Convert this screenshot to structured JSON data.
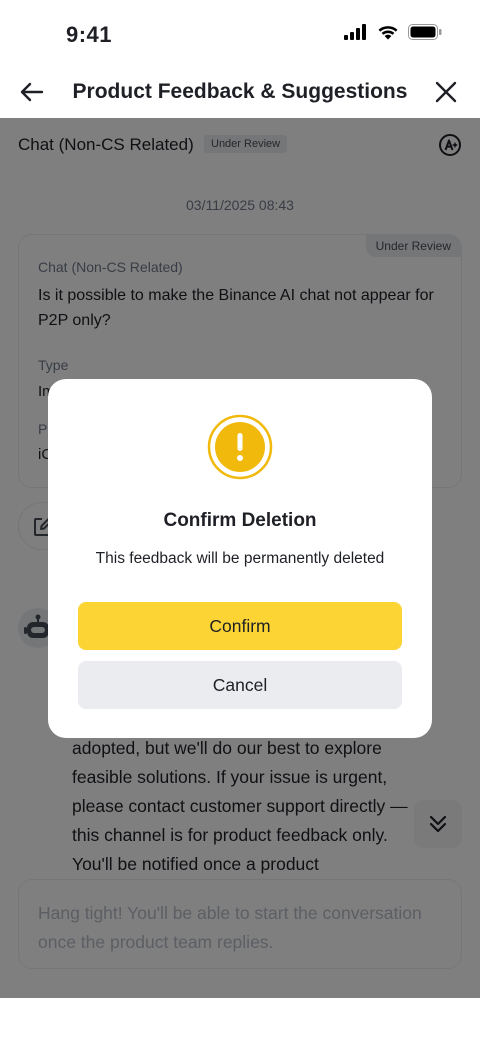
{
  "status_bar": {
    "time": "9:41",
    "icons": [
      "signal-icon",
      "wifi-icon",
      "battery-icon"
    ]
  },
  "nav": {
    "title": "Product Feedback & Suggestions",
    "back_icon": "arrow-left-icon",
    "close_icon": "close-icon"
  },
  "chat_header": {
    "title": "Chat (Non-CS Related)",
    "status_badge": "Under Review",
    "ai_icon": "ai-chip-icon"
  },
  "timestamp": "03/11/2025 08:43",
  "feedback_card": {
    "status_badge": "Under Review",
    "category": "Chat (Non-CS Related)",
    "question": "Is it possible to make the Binance AI chat not appear for P2P only?",
    "type_label": "Type",
    "type_value": "Im",
    "platform_label": "Pl",
    "platform_value": "iC"
  },
  "bot_message": "adopted, but we'll do our best to explore feasible solutions. If your issue is urgent, please contact customer support directly — this channel is for product feedback only. You'll be notified once a product",
  "input": {
    "placeholder": "Hang tight! You'll be able to start the conversation once the product team replies."
  },
  "modal": {
    "icon": "warning-icon",
    "title": "Confirm Deletion",
    "message": "This feedback will be permanently deleted",
    "confirm_label": "Confirm",
    "cancel_label": "Cancel"
  },
  "colors": {
    "accent_yellow": "#fcd535",
    "warning_ring": "#f0b90b",
    "overlay": "rgba(0,0,0,0.5)"
  }
}
